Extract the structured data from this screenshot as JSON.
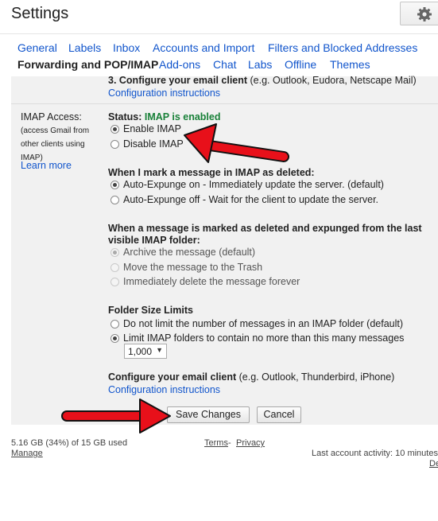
{
  "header": {
    "title": "Settings",
    "gear_icon": "gear-icon"
  },
  "tabs": [
    {
      "label": "General"
    },
    {
      "label": "Labels"
    },
    {
      "label": "Inbox"
    },
    {
      "label": "Accounts and Import"
    },
    {
      "label": "Filters and Blocked Addresses"
    },
    {
      "label": "Forwarding and POP/IMAP",
      "active": true
    },
    {
      "label": "Add-ons"
    },
    {
      "label": "Chat"
    },
    {
      "label": "Labs"
    },
    {
      "label": "Offline"
    },
    {
      "label": "Themes"
    }
  ],
  "pop_section": {
    "configure_bold": "3. Configure your email client",
    "configure_rest": " (e.g. Outlook, Eudora, Netscape Mail)",
    "instructions_link": "Configuration instructions"
  },
  "imap": {
    "heading": "IMAP Access:",
    "desc": [
      "(access Gmail from",
      "other clients using",
      "IMAP)"
    ],
    "learn_more": "Learn more",
    "status_label": "Status: ",
    "status_value": "IMAP is enabled",
    "status_color": "#188038",
    "enable_label": "Enable IMAP",
    "disable_label": "Disable IMAP",
    "enabled": true,
    "deleted_heading": "When I mark a message in IMAP as deleted:",
    "expunge_on": "Auto-Expunge on - Immediately update the server. (default)",
    "expunge_off": "Auto-Expunge off - Wait for the client to update the server.",
    "expunged_heading_1": "When a message is marked as deleted and expunged from the last",
    "expunged_heading_2": "visible IMAP folder:",
    "archive": "Archive the message (default)",
    "trash": "Move the message to the Trash",
    "delete_forever": "Immediately delete the message forever",
    "folder_heading": "Folder Size Limits",
    "no_limit": "Do not limit the number of messages in an IMAP folder (default)",
    "limit": "Limit IMAP folders to contain no more than this many messages",
    "limit_value": "1,000",
    "client_bold": "Configure your email client",
    "client_rest": " (e.g. Outlook, Thunderbird, iPhone)",
    "client_link": "Configuration instructions"
  },
  "actions": {
    "save": "Save Changes",
    "cancel": "Cancel"
  },
  "footer": {
    "storage": "5.16 GB (34%) of 15 GB used",
    "manage": "Manage",
    "terms": "Terms",
    "sep": " - ",
    "privacy": "Privacy",
    "activity": "Last account activity: 10 minutes",
    "details": "De"
  },
  "colors": {
    "link": "#1155cc",
    "annotation_arrow": "#e8101a"
  }
}
